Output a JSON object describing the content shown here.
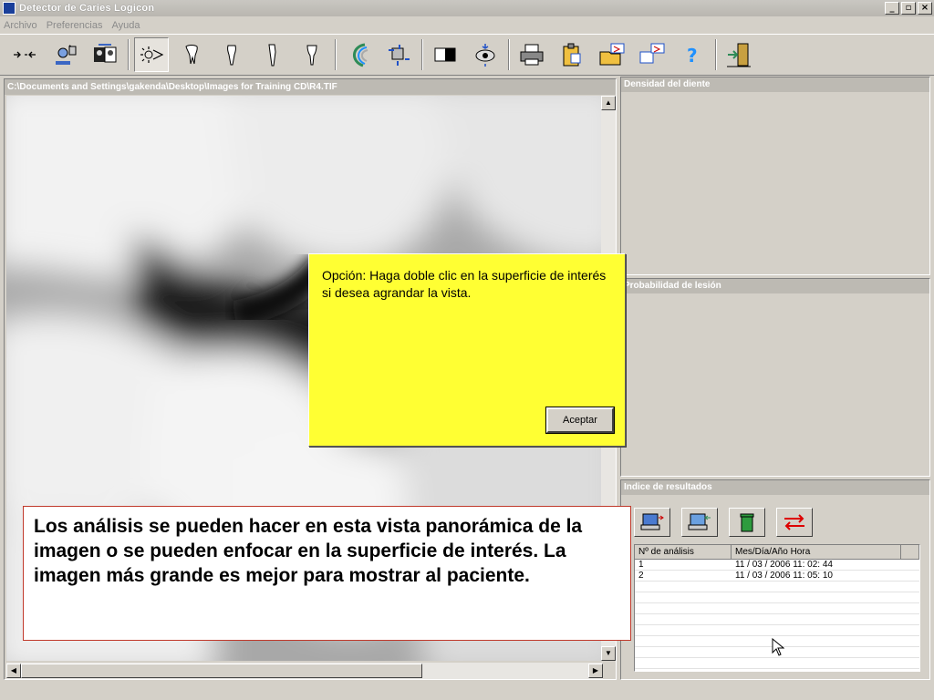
{
  "window": {
    "title": "Detector de Caries Logicon",
    "buttons": [
      "_",
      "▫",
      "×"
    ]
  },
  "menu": [
    "Archivo",
    "Preferencias",
    "Ayuda"
  ],
  "toolbar": {
    "icons": [
      "arrows-icon",
      "user-scan-icon",
      "patient-photo-icon",
      "light-ray-icon",
      "tooth-molar-icon",
      "tooth-incisor-icon",
      "tooth-canine-icon",
      "tooth-premolar-icon",
      "arc-rainbow-icon",
      "transfer-icon",
      "contrast-icon",
      "eye-icon",
      "printer-icon",
      "clipboard-icon",
      "folder-export-icon",
      "window-export-icon",
      "help-icon",
      "exit-door-icon"
    ]
  },
  "image_panel": {
    "path": "C:\\Documents and Settings\\gakenda\\Desktop\\Images for Training CD\\R4.TIF"
  },
  "panels": {
    "density_title": "Densidad del diente",
    "probability_title": "Probabilidad de lesión",
    "results_title": "Indice de resultados"
  },
  "results_table": {
    "headers": [
      "Nº de análisis",
      "Mes/Día/Año  Hora"
    ],
    "rows": [
      {
        "n": "1",
        "datetime": "11 / 03 / 2006   11: 02: 44"
      },
      {
        "n": "2",
        "datetime": "11 / 03 / 2006   11: 05: 10"
      }
    ]
  },
  "dialog": {
    "message": "Opción: Haga doble clic en la superficie de interés si desea agrandar la vista.",
    "ok_label": "Aceptar"
  },
  "caption": {
    "text": "Los análisis se pueden hacer en esta vista panorámica de la imagen o se pueden enfocar en la superficie de interés. La imagen más grande es mejor para mostrar al paciente."
  },
  "colors": {
    "dialog_bg": "#ffff33",
    "caption_border": "#c0392b",
    "panel_title_bg": "#bdbab3"
  }
}
